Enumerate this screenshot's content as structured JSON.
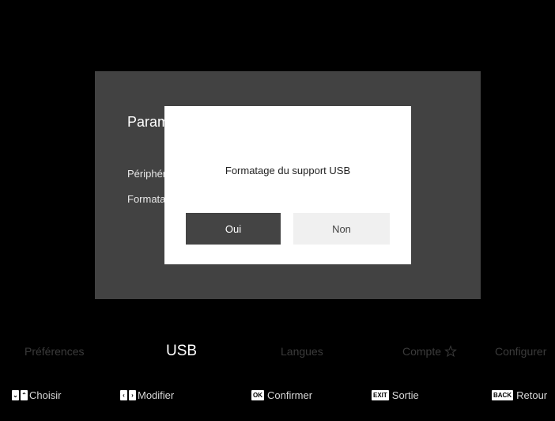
{
  "panel": {
    "title": "Paramètres USB",
    "rows": [
      "Périphérique USB",
      "Formatage du support USB"
    ]
  },
  "dialog": {
    "message": "Formatage du support USB",
    "yes_label": "Oui",
    "no_label": "Non"
  },
  "tabs": [
    {
      "label": "Préférences",
      "active": false
    },
    {
      "label": "USB",
      "active": true
    },
    {
      "label": "Langues",
      "active": false
    },
    {
      "label": "Compte",
      "active": false,
      "icon": "star-icon"
    },
    {
      "label": "Configurer",
      "active": false
    }
  ],
  "hints": {
    "choisir": {
      "keys": [
        "⌄",
        "⌃"
      ],
      "label": "Choisir"
    },
    "modifier": {
      "keys": [
        "‹",
        "›"
      ],
      "label": "Modifier"
    },
    "confirmer": {
      "key": "OK",
      "label": "Confirmer"
    },
    "sortie": {
      "key": "EXIT",
      "label": "Sortie"
    },
    "retour": {
      "key": "BACK",
      "label": "Retour"
    }
  },
  "colors": {
    "background": "#000000",
    "panel": "#424242",
    "dialog": "#ffffff",
    "button_selected": "#444444",
    "button_unselected": "#f0f0f0",
    "tab_inactive": "#3b3b3b"
  }
}
